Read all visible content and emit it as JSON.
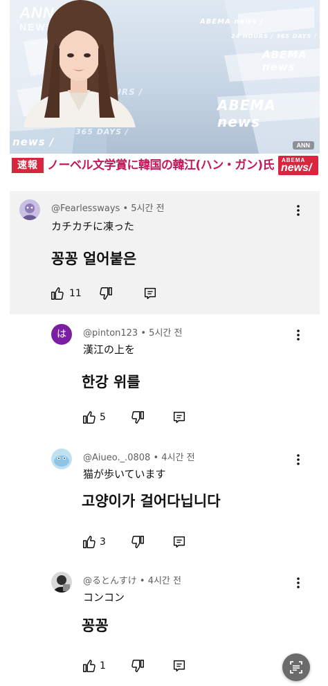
{
  "video": {
    "watermark_logo_top": "ANN",
    "watermark_logo_bottom": "NEWS",
    "watermarks": [
      "24 HOURS /",
      "365 DAYS /",
      "ABEMA news /",
      "news /",
      "ABEMA news",
      "24 HOURS / 365 DAYS /",
      "ABEMA news"
    ],
    "ann_small": "ANN",
    "breaking_label": "速報",
    "headline": "ノーベル文学賞に韓国の韓江(ハン・ガン)氏",
    "badge_top": "ABEMA",
    "badge_bottom": "news/"
  },
  "comments": [
    {
      "handle": "@Fearlessways",
      "time": "5시간 전",
      "japanese": "カチカチに凍った",
      "korean": "꽁꽁 얼어붙은",
      "likes": "11",
      "avatar_color": "#a393c8"
    },
    {
      "handle": "@pinton123",
      "time": "5시간 전",
      "avatar_letter": "は",
      "japanese": "漢江の上を",
      "korean": "한강 위를",
      "likes": "5",
      "avatar_color": "#7b1fa2"
    },
    {
      "handle": "@Aiueo._.0808",
      "time": "4시간 전",
      "japanese": "猫が歩いています",
      "korean": "고양이가 걸어다닙니다",
      "likes": "3",
      "avatar_color": "#8ec5e6"
    },
    {
      "handle": "@るとんすけ",
      "time": "4시간 전",
      "japanese": "コンコン",
      "korean": "꽁꽁",
      "likes": "1",
      "avatar_color": "#3a3a3a"
    }
  ],
  "icons": {
    "like": "thumbs-up-icon",
    "dislike": "thumbs-down-icon",
    "reply": "reply-icon",
    "more": "more-vert-icon",
    "lens": "scan-lens-icon"
  }
}
